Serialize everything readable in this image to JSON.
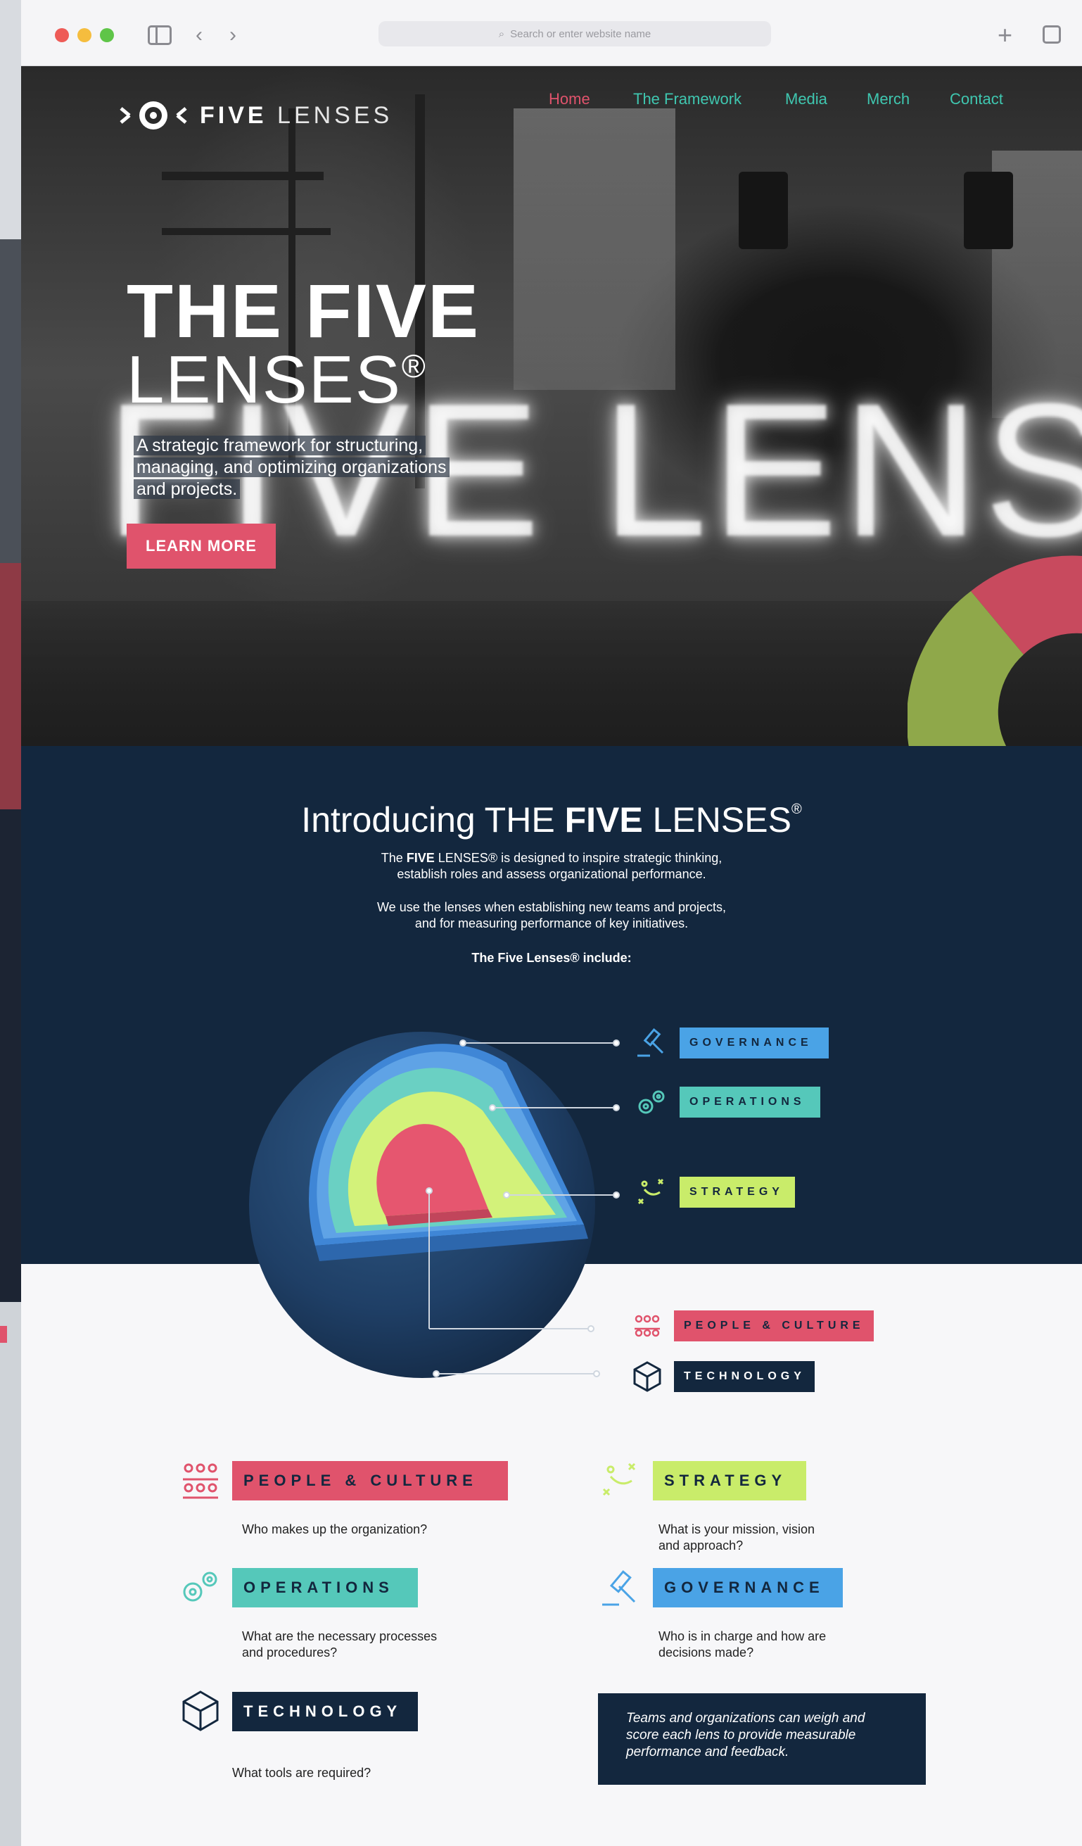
{
  "browser": {
    "address_placeholder": "Search or enter website name"
  },
  "site": {
    "logo_bold": "FIVE",
    "logo_light": "LENSES",
    "nav": [
      {
        "label": "Home",
        "active": true
      },
      {
        "label": "The Framework",
        "active": false
      },
      {
        "label": "Media",
        "active": false
      },
      {
        "label": "Merch",
        "active": false
      },
      {
        "label": "Contact",
        "active": false
      }
    ]
  },
  "hero": {
    "title_line1": "THE FIVE",
    "title_line2": "LENSES",
    "title_mark": "®",
    "background_word": "FIVE LENSES",
    "subtitle": "A strategic framework for structuring, managing, and optimizing organizations and projects.",
    "cta_label": "LEARN MORE"
  },
  "intro": {
    "title_prefix": "Introducing THE ",
    "title_bold": "FIVE",
    "title_suffix": " LENSES",
    "title_mark": "®",
    "p1_line1_pre": "The ",
    "p1_line1_bold": "FIVE",
    "p1_line1_post": " LENSES® is designed to inspire strategic thinking,",
    "p1_line2": "establish roles and assess organizational performance.",
    "p2_line1": "We use the lenses when establishing new teams and projects,",
    "p2_line2": "and for measuring performance of key initiatives.",
    "p3": "The Five Lenses® include:"
  },
  "diagram_tags": {
    "governance": "GOVERNANCE",
    "operations": "OPERATIONS",
    "strategy": "STRATEGY",
    "people": "PEOPLE & CULTURE",
    "technology": "TECHNOLOGY"
  },
  "lenses": {
    "people": {
      "label": "PEOPLE & CULTURE",
      "question": "Who makes up the organization?"
    },
    "strategy": {
      "label": "STRATEGY",
      "question_line1": "What is your mission, vision",
      "question_line2": "and approach?"
    },
    "operations": {
      "label": "OPERATIONS",
      "question_line1": "What are the necessary processes",
      "question_line2": "and procedures?"
    },
    "governance": {
      "label": "GOVERNANCE",
      "question_line1": "Who is in charge and how are",
      "question_line2": "decisions made?"
    },
    "technology": {
      "label": "TECHNOLOGY",
      "question": "What tools are required?"
    }
  },
  "score_note": {
    "line1": "Teams and organizations can weigh and",
    "line2": "score each lens to provide measurable",
    "line3": "performance and feedback."
  },
  "colors": {
    "pink": "#e0536c",
    "teal": "#55c8ba",
    "blue": "#4aa3e6",
    "lime": "#c9ec6a",
    "navy": "#13273e",
    "nav_link": "#3fc7b0"
  }
}
